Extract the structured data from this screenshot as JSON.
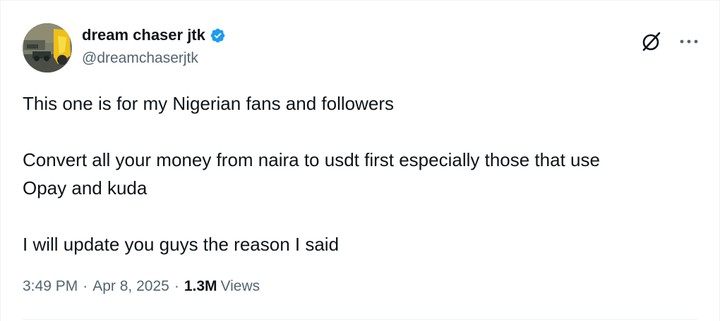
{
  "author": {
    "display_name": "dream chaser jtk",
    "handle": "@dreamchaserjtk",
    "verified": true,
    "verified_color": "#1d9bf0"
  },
  "icons": {
    "verified": "verified-badge-icon",
    "grok": "grok-icon",
    "more": "more-options-icon"
  },
  "tweet": {
    "paragraph_1": "This one is for my Nigerian fans and followers",
    "paragraph_2_line_1": "Convert all your money from naira to usdt first especially those that use",
    "paragraph_2_line_2": "Opay and kuda",
    "paragraph_3": "I will update you guys the reason I said"
  },
  "meta": {
    "time": "3:49 PM",
    "separator": "·",
    "date": "Apr 8, 2025",
    "views_count": "1.3M",
    "views_label": "Views"
  },
  "colors": {
    "text_primary": "#0f1419",
    "text_secondary": "#536471",
    "border": "#eff3f4"
  }
}
